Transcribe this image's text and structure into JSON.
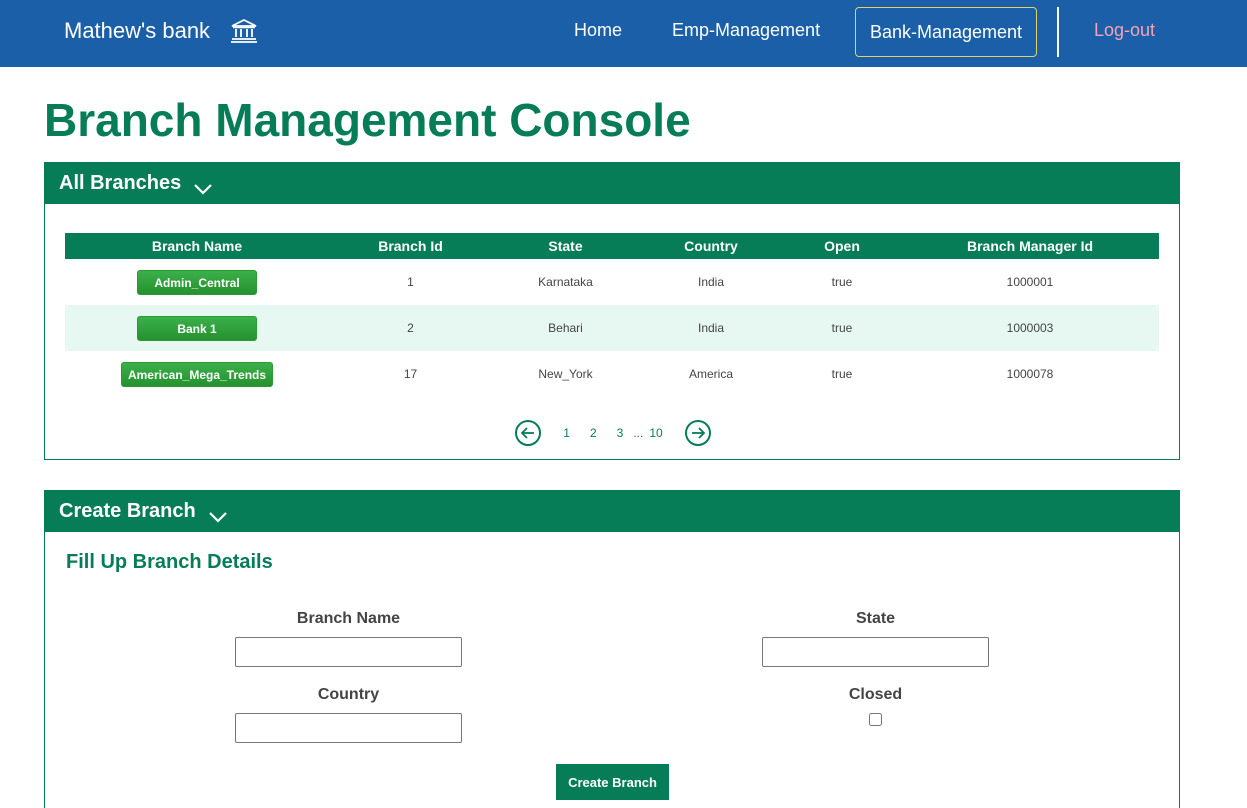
{
  "navbar": {
    "brand": "Mathew's bank",
    "brand_icon": "bank-icon",
    "links": {
      "home": "Home",
      "emp": "Emp-Management",
      "bank": "Bank-Management",
      "logout": "Log-out"
    },
    "colors": {
      "background": "#1a5fa8",
      "logout": "#f5a3b8",
      "active_border": "#e0d36a"
    }
  },
  "page_title": "Branch Management Console",
  "branches_panel": {
    "title": "All Branches",
    "columns": [
      "Branch Name",
      "Branch Id",
      "State",
      "Country",
      "Open",
      "Branch Manager Id"
    ],
    "rows": [
      {
        "name": "Admin_Central",
        "id": "1",
        "state": "Karnataka",
        "country": "India",
        "open": "true",
        "manager": "1000001"
      },
      {
        "name": "Bank 1",
        "id": "2",
        "state": "Behari",
        "country": "India",
        "open": "true",
        "manager": "1000003"
      },
      {
        "name": "American_Mega_Trends",
        "id": "17",
        "state": "New_York",
        "country": "America",
        "open": "true",
        "manager": "1000078"
      }
    ],
    "pagination": {
      "pages": [
        "1",
        "2",
        "3"
      ],
      "ellipsis": "...",
      "last": "10",
      "prev_icon": "arrow-left-circle-icon",
      "next_icon": "arrow-right-circle-icon"
    }
  },
  "create_panel": {
    "title": "Create Branch",
    "form_title": "Fill Up Branch Details",
    "fields": {
      "branch_name": {
        "label": "Branch Name",
        "value": ""
      },
      "state": {
        "label": "State",
        "value": ""
      },
      "country": {
        "label": "Country",
        "value": ""
      },
      "closed": {
        "label": "Closed",
        "checked": false
      }
    },
    "submit_label": "Create Branch"
  },
  "accent_color": "#077d57"
}
